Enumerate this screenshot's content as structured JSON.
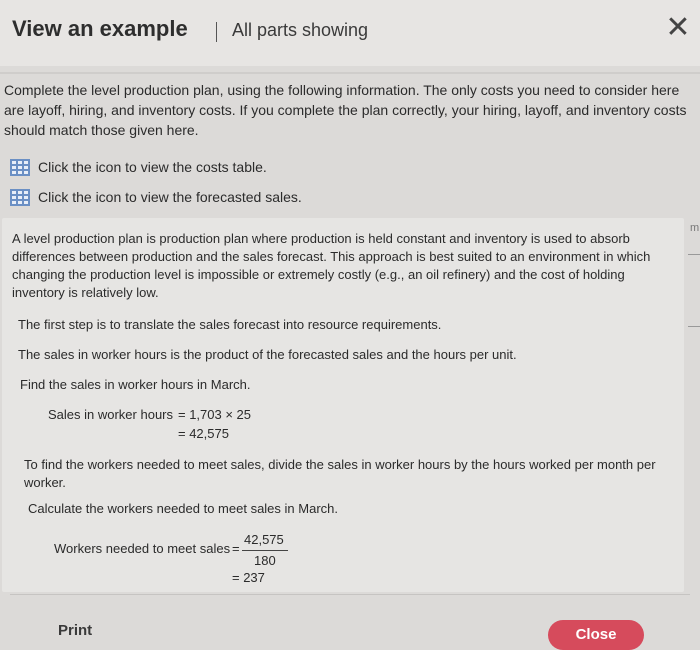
{
  "header": {
    "title": "View an example",
    "subtitle": "All parts showing",
    "close_icon": "close-icon"
  },
  "intro": "Complete the level production plan, using the following information. The only costs you need to consider here are layoff, hiring, and inventory costs. If you complete the plan correctly, your hiring, layoff, and inventory costs should match those given here.",
  "links": [
    {
      "icon": "table-grid-icon",
      "label": "Click the icon to view the costs table."
    },
    {
      "icon": "table-grid-icon",
      "label": "Click the icon to view the forecasted sales."
    }
  ],
  "content": {
    "p1": "A level production plan is production plan where production is held constant and inventory is used to absorb differences between production and the sales forecast. This approach is best suited to an environment in which changing the production level is impossible or extremely costly (e.g., an oil refinery) and the cost of holding inventory is relatively low.",
    "p2": "The first step is to translate the sales forecast into resource requirements.",
    "p3": "The sales in worker hours is the product of the forecasted sales and the hours per unit.",
    "p4": "Find the sales in worker hours in March.",
    "eq1_label": "Sales in worker hours",
    "eq1_line1": "= 1,703 × 25",
    "eq1_line2": "= 42,575",
    "p5": "To find the workers needed to meet sales, divide the sales in worker hours by the hours worked per month per worker.",
    "p6": "Calculate the workers needed to meet sales in March.",
    "eq2_label": "Workers needed to meet sales",
    "eq2_eq": "=",
    "eq2_num": "42,575",
    "eq2_den": "180",
    "eq2_result": "= 237"
  },
  "side_mark": "m",
  "footer": {
    "print_label": "Print",
    "close_label": "Close",
    "close_color": "#d64b5c"
  }
}
